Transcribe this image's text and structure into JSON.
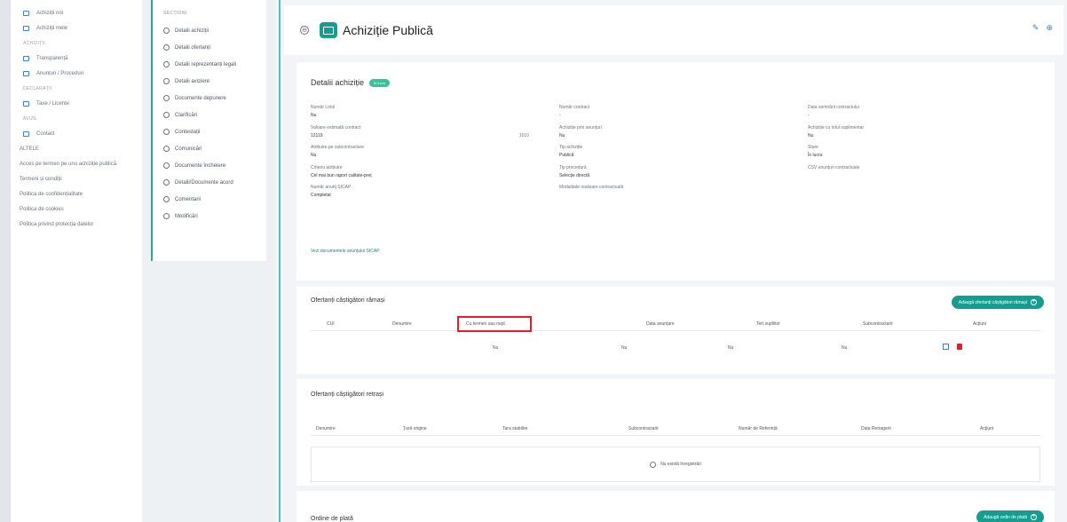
{
  "left_nav": [
    {
      "label": "Achiziții noi",
      "type": "item"
    },
    {
      "label": "Achiziții mele",
      "type": "item"
    },
    {
      "label": "ACHIZIȚII",
      "type": "header"
    },
    {
      "label": "Transparență",
      "type": "item"
    },
    {
      "label": "Anunțuri / Proceduri",
      "type": "item"
    },
    {
      "label": "DECLARAȚII",
      "type": "header"
    },
    {
      "label": "Taxe / Licențe",
      "type": "item"
    },
    {
      "label": "AVIZE",
      "type": "header"
    },
    {
      "label": "Contact",
      "type": "item"
    },
    {
      "label": "ALTELE",
      "type": "plain"
    },
    {
      "label": "Acces pe termen pe unu achiziție publică",
      "type": "plain"
    },
    {
      "label": "Termeni și condiții",
      "type": "plain"
    },
    {
      "label": "Politica de confidențialitate",
      "type": "plain"
    },
    {
      "label": "Politica de cookies",
      "type": "plain"
    },
    {
      "label": "Politica privind protecția datelor",
      "type": "plain"
    }
  ],
  "section_nav": {
    "title": "SECȚIUNI",
    "items": [
      "Detalii achiziții",
      "Detalii ofertanți",
      "Detalii reprezentanți legali",
      "Detalii aviziere",
      "Documente depunere",
      "Clarificări",
      "Contestații",
      "Comunicări",
      "Documente încheiere",
      "Detalii/Documente acord",
      "Comentarii",
      "Modificări"
    ]
  },
  "header": {
    "title": "Achiziție Publică",
    "back_icon": "⊖",
    "edit_icon": "✎",
    "more_icon": "⊕"
  },
  "details": {
    "title": "Detalii achiziție",
    "badge": "În lucru",
    "fields": [
      {
        "label": "Număr Lotul",
        "value": "Nu"
      },
      {
        "label": "Număr contract",
        "value": "-"
      },
      {
        "label": "Data semnării contractului",
        "value": "-"
      },
      {
        "label": "Valoare estimată contract",
        "value": "12119",
        "extra": "1010"
      },
      {
        "label": "Achiziție prin anunțuri",
        "value": "Nu"
      },
      {
        "label": "Achiziție cu lotul suplimentar",
        "value": "Nu"
      },
      {
        "label": "Atribuire pe subcontractare",
        "value": "Nu"
      },
      {
        "label": "Tip achiziție",
        "value": "Publică"
      },
      {
        "label": "Stare",
        "value": "În lucru"
      },
      {
        "label": "Criteriu atribuire",
        "value": "Cel mai bun raport calitate-preț"
      },
      {
        "label": "Tip procedură",
        "value": "Selecție directă"
      },
      {
        "label": "CSV anunțuri contractuale",
        "value": ""
      },
      {
        "label": "Număr anunț SICAP",
        "value": "Completat"
      },
      {
        "label": "Modalitate realizare contractuală",
        "value": ""
      }
    ],
    "link": "Vezi documentele anunțului SICAP"
  },
  "remaining": {
    "title": "Ofertanți căștigători rămași",
    "button": "Adaugă ofertanți căștigători rămași",
    "columns": [
      "CUI",
      "Denumire",
      "Cu termen sau nepl.",
      "Data anunțare",
      "Tert supliitor",
      "Subcontractant",
      "Acțiuni"
    ],
    "row": [
      "",
      "",
      "Nu",
      "Nu",
      "Nu",
      "Nu",
      ""
    ]
  },
  "withdrawn": {
    "title": "Ofertanți căștigători retrași",
    "columns": [
      "Denumire",
      "Țară origine",
      "Tara stabilire",
      "Subcontractant",
      "Număr de Referință",
      "Data Retragerii",
      "Acțiuni"
    ],
    "empty": "Nu există înregistrări"
  },
  "orders": {
    "title": "Ordine de plată",
    "button": "Adaugă ordin de plată"
  },
  "colors": {
    "accent": "#159d8f",
    "highlight": "#e11d2e"
  }
}
